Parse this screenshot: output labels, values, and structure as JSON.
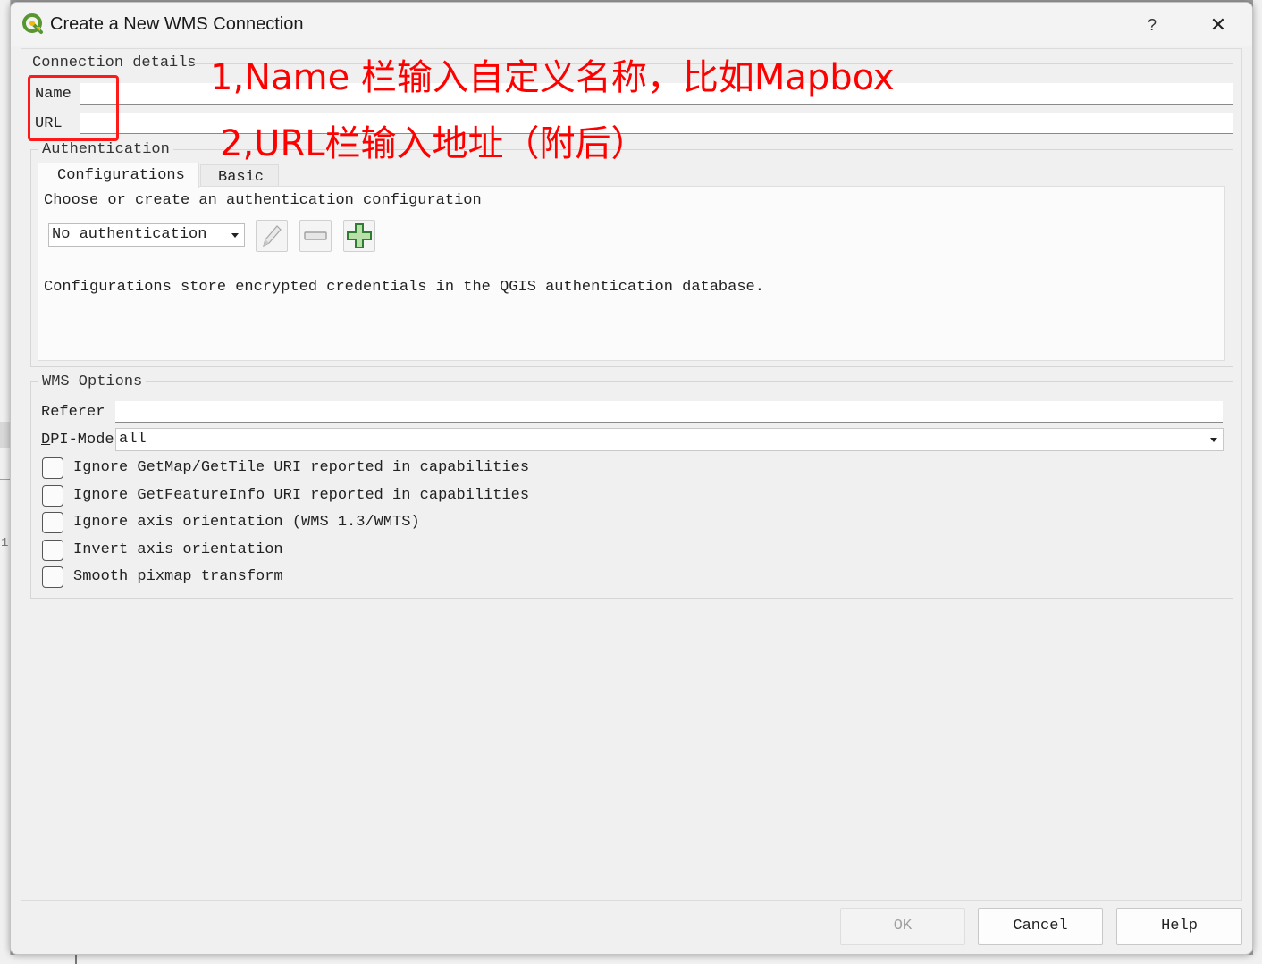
{
  "window": {
    "title": "Create a New WMS Connection",
    "help_glyph": "?",
    "close_glyph": "✕"
  },
  "connection_details": {
    "group_title": "Connection details",
    "name_label": "Name",
    "name_value": "",
    "url_label": "URL",
    "url_value": ""
  },
  "authentication": {
    "group_title": "Authentication",
    "tabs": [
      {
        "label": "Configurations",
        "active": true
      },
      {
        "label": "Basic",
        "active": false
      }
    ],
    "choose_text": "Choose or create an authentication configuration",
    "selected_config": "No authentication",
    "info_text": "Configurations store encrypted credentials in the QGIS authentication database.",
    "icons": [
      "edit-pencil-icon",
      "remove-minus-icon",
      "add-plus-icon"
    ]
  },
  "wms_options": {
    "group_title": "WMS Options",
    "referer_label": "Referer",
    "referer_value": "",
    "dpi_label_accel": "D",
    "dpi_label_rest": "PI-Mode",
    "dpi_value": "all",
    "checkboxes": [
      {
        "label": "Ignore GetMap/GetTile URI reported in capabilities",
        "checked": false
      },
      {
        "label": "Ignore GetFeatureInfo URI reported in capabilities",
        "checked": false
      },
      {
        "label": "Ignore axis orientation (WMS 1.3/WMTS)",
        "checked": false
      },
      {
        "label": "Invert axis orientation",
        "checked": false
      },
      {
        "label": "Smooth pixmap transform",
        "checked": false
      }
    ]
  },
  "buttons": {
    "ok": "OK",
    "cancel": "Cancel",
    "help": "Help"
  },
  "annotations": {
    "line1": "1,Name 栏输入自定义名称，比如Mapbox",
    "line2": "2,URL栏输入地址（附后）",
    "color": "#ff0000"
  }
}
